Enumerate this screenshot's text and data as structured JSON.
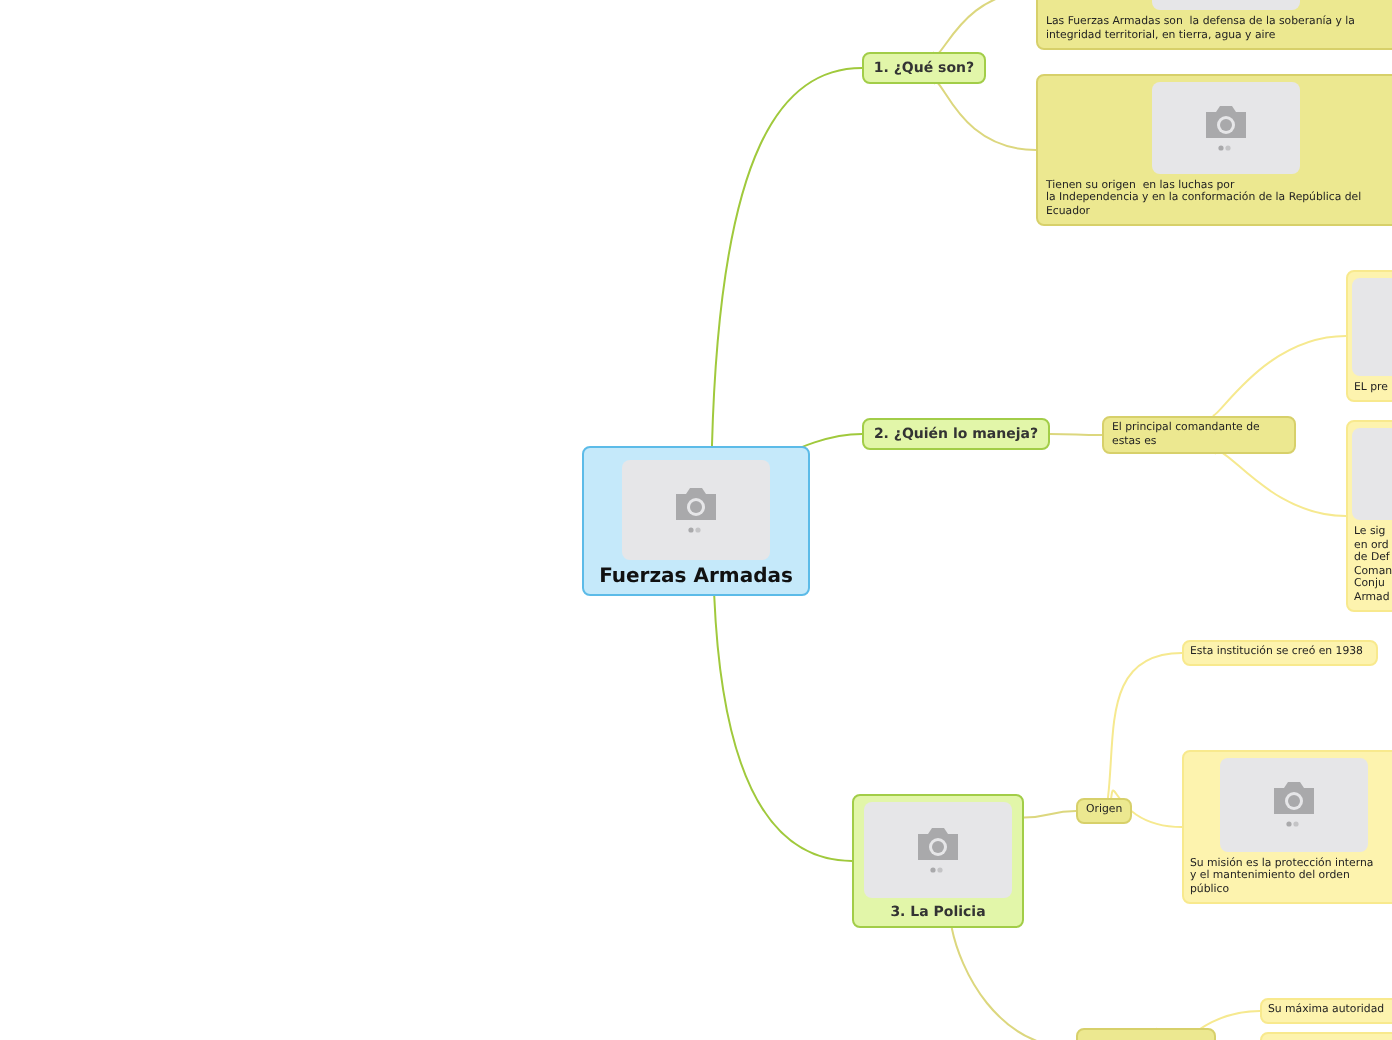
{
  "root": {
    "label": "Fuerzas Armadas",
    "image": true,
    "children": [
      {
        "label": "1. ¿Qué son?",
        "image": false,
        "children": [
          {
            "label": "Las Fuerzas Armadas son  la defensa de la soberanía y la\nintegridad territorial, en tierra, agua y aire",
            "image": true
          },
          {
            "label": "Tienen su origen  en las luchas por\nla Independencia y en la conformación de la República del\nEcuador",
            "image": true
          }
        ]
      },
      {
        "label": "2. ¿Quién lo maneja?",
        "image": false,
        "children": [
          {
            "label": "El principal comandante de\nestas es",
            "image": false,
            "children": [
              {
                "label": "EL pre",
                "image": true
              },
              {
                "label": "Le sig\nen ord\nde Def\nComan\nConju\nArmad",
                "image": true
              }
            ]
          }
        ]
      },
      {
        "label": "3. La Policia",
        "image": true,
        "children": [
          {
            "label": "Origen",
            "image": false,
            "children": [
              {
                "label": "Esta institución se creó en 1938",
                "image": false
              },
              {
                "label": "Su misión es la protección interna\ny el mantenimiento del orden\npúblico",
                "image": true
              }
            ]
          },
          {
            "image": false,
            "children": [
              {
                "label": "Su máxima autoridad",
                "image": false
              },
              {
                "image": false
              }
            ]
          }
        ]
      }
    ]
  }
}
